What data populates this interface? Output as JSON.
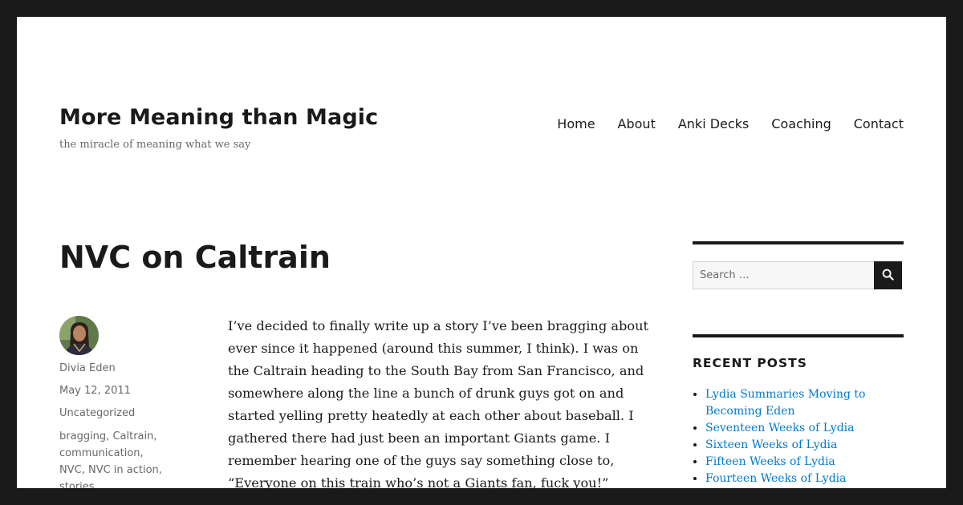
{
  "site": {
    "title": "More Meaning than Magic",
    "tagline": "the miracle of meaning what we say"
  },
  "nav": [
    "Home",
    "About",
    "Anki Decks",
    "Coaching",
    "Contact"
  ],
  "post": {
    "title": "NVC on Caltrain",
    "author": "Divia Eden",
    "date": "May 12, 2011",
    "category": "Uncategorized",
    "tags": [
      "bragging",
      "Caltrain",
      "communication",
      "NVC",
      "NVC in action",
      "stories"
    ],
    "body": "I’ve decided to finally write up a story I’ve been bragging about ever since it happened (around this summer, I think). I was on the Caltrain heading to the South Bay from San Francisco, and somewhere along the line a bunch of drunk guys got on and started yelling pretty heatedly at each other about baseball. I gathered there had just been an important Giants game. I remember hearing one of the guys say something close to, “Everyone on this train who’s not a Giants fan, fuck you!”"
  },
  "sidebar": {
    "search_placeholder": "Search …",
    "search_icon": "search-icon",
    "recent_posts_title": "RECENT POSTS",
    "recent_posts": [
      "Lydia Summaries Moving to Becoming Eden",
      "Seventeen Weeks of Lydia",
      "Sixteen Weeks of Lydia",
      "Fifteen Weeks of Lydia",
      "Fourteen Weeks of Lydia"
    ]
  },
  "colors": {
    "frame": "#1a1a1a",
    "link": "#007acc",
    "meta_text": "#686868"
  }
}
